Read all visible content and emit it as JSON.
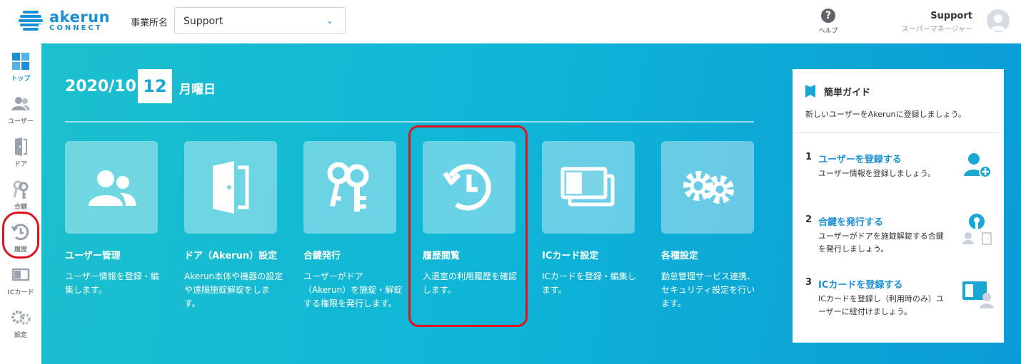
{
  "header": {
    "logo_text": "akerun",
    "logo_sub": "CONNECT",
    "office_label": "事業所名",
    "office_value": "Support",
    "help_label": "ヘルプ",
    "user_name": "Support",
    "user_role": "スーパーマネージャー"
  },
  "sidebar": {
    "items": [
      {
        "label": "トップ",
        "icon": "top-grid-icon"
      },
      {
        "label": "ユーザー",
        "icon": "users-icon"
      },
      {
        "label": "ドア",
        "icon": "door-icon"
      },
      {
        "label": "合鍵",
        "icon": "key-icon"
      },
      {
        "label": "履歴",
        "icon": "history-icon"
      },
      {
        "label": "ICカード",
        "icon": "ic-card-icon"
      },
      {
        "label": "設定",
        "icon": "gear-icon"
      }
    ]
  },
  "main": {
    "date_ym": "2020/10",
    "date_day": "12",
    "date_weekday": "月曜日",
    "cards": [
      {
        "title": "ユーザー管理",
        "desc": "ユーザー情報を登録・編集します。",
        "icon": "users-icon"
      },
      {
        "title": "ドア（Akerun）設定",
        "desc": "Akerun本体や機器の設定や遠隔施錠解錠をします。",
        "icon": "door-icon"
      },
      {
        "title": "合鍵発行",
        "desc": "ユーザーがドア（Akerun）を施錠・解錠する権限を発行します。",
        "icon": "key-icon"
      },
      {
        "title": "履歴閲覧",
        "desc": "入退室の利用履歴を確認します。",
        "icon": "history-icon"
      },
      {
        "title": "ICカード設定",
        "desc": "ICカードを登録・編集します。",
        "icon": "ic-card-icon"
      },
      {
        "title": "各種設定",
        "desc": "勤怠管理サービス連携、セキュリティ設定を行います。",
        "icon": "gear-icon"
      }
    ]
  },
  "guide": {
    "title": "簡単ガイド",
    "subtitle": "新しいユーザーをAkerunに登録しましょう。",
    "steps": [
      {
        "num": "1",
        "title": "ユーザーを登録する",
        "desc": "ユーザー情報を登録しましょう。",
        "icon": "add-user-icon"
      },
      {
        "num": "2",
        "title": "合鍵を発行する",
        "desc": "ユーザーがドアを施錠解錠する合鍵を発行しましょう。",
        "icon": "key-user-icon"
      },
      {
        "num": "3",
        "title": "ICカードを登録する",
        "desc": "ICカードを登録し（利用時のみ）ユーザーに紐付けましょう。",
        "icon": "ic-card-user-icon"
      }
    ]
  },
  "colors": {
    "accent": "#1b8fd6",
    "highlight": "#e0131d",
    "main_bg": "#10b8d4"
  }
}
